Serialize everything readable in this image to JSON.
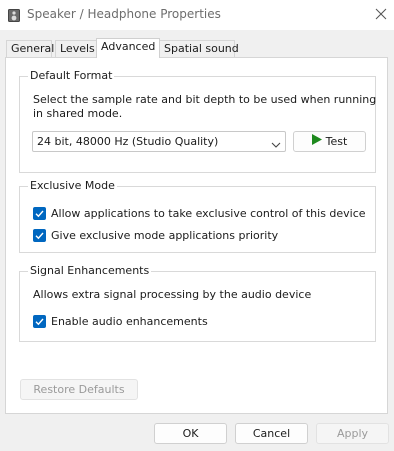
{
  "window": {
    "title": "Speaker / Headphone Properties"
  },
  "tabs": [
    {
      "label": "General"
    },
    {
      "label": "Levels"
    },
    {
      "label": "Advanced"
    },
    {
      "label": "Spatial sound"
    }
  ],
  "default_format": {
    "heading": "Default Format",
    "description_line1": "Select the sample rate and bit depth to be used when running",
    "description_line2": "in shared mode.",
    "selected_format": "24 bit, 48000 Hz (Studio Quality)",
    "test_label": "Test"
  },
  "exclusive_mode": {
    "heading": "Exclusive Mode",
    "allow_label": "Allow applications to take exclusive control of this device",
    "allow_checked": true,
    "priority_label": "Give exclusive mode applications priority",
    "priority_checked": true
  },
  "signal_enhancements": {
    "heading": "Signal Enhancements",
    "description": "Allows extra signal processing by the audio device",
    "enable_label": "Enable audio enhancements",
    "enable_checked": true
  },
  "buttons": {
    "restore_defaults": "Restore Defaults",
    "ok": "OK",
    "cancel": "Cancel",
    "apply": "Apply"
  },
  "colors": {
    "accent": "#0067c0",
    "play_green": "#1e8a1e"
  }
}
